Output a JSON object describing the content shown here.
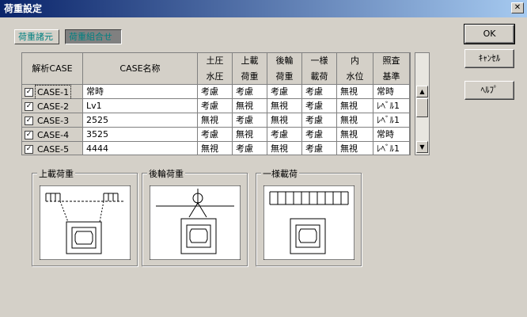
{
  "window": {
    "title": "荷重設定",
    "close_glyph": "✕"
  },
  "tabs": [
    {
      "label": "荷重諸元",
      "active": false
    },
    {
      "label": "荷重組合せ",
      "active": true
    }
  ],
  "table": {
    "headers": [
      {
        "line1": "解析CASE",
        "line2": ""
      },
      {
        "line1": "CASE名称",
        "line2": ""
      },
      {
        "line1": "土圧",
        "line2": "水圧"
      },
      {
        "line1": "上載",
        "line2": "荷重"
      },
      {
        "line1": "後輪",
        "line2": "荷重"
      },
      {
        "line1": "一様",
        "line2": "載荷"
      },
      {
        "line1": "内",
        "line2": "水位"
      },
      {
        "line1": "照査",
        "line2": "基準"
      }
    ],
    "rows": [
      {
        "checked": true,
        "case_id": "CASE-1",
        "name": "常時",
        "c1": "考慮",
        "c2": "考慮",
        "c3": "考慮",
        "c4": "考慮",
        "c5": "無視",
        "c6": "常時"
      },
      {
        "checked": true,
        "case_id": "CASE-2",
        "name": "Lv1",
        "c1": "考慮",
        "c2": "無視",
        "c3": "無視",
        "c4": "考慮",
        "c5": "無視",
        "c6": "ﾚﾍﾞﾙ1"
      },
      {
        "checked": true,
        "case_id": "CASE-3",
        "name": "2525",
        "c1": "無視",
        "c2": "考慮",
        "c3": "無視",
        "c4": "考慮",
        "c5": "無視",
        "c6": "ﾚﾍﾞﾙ1"
      },
      {
        "checked": true,
        "case_id": "CASE-4",
        "name": "3525",
        "c1": "考慮",
        "c2": "無視",
        "c3": "考慮",
        "c4": "考慮",
        "c5": "無視",
        "c6": "常時"
      },
      {
        "checked": true,
        "case_id": "CASE-5",
        "name": "4444",
        "c1": "無視",
        "c2": "考慮",
        "c3": "無視",
        "c4": "考慮",
        "c5": "無視",
        "c6": "ﾚﾍﾞﾙ1"
      }
    ],
    "check_glyph": "✓"
  },
  "panels": [
    {
      "label": "上載荷重"
    },
    {
      "label": "後輪荷重"
    },
    {
      "label": "一様載荷"
    }
  ],
  "buttons": {
    "ok": "OK",
    "cancel": "ｷｬﾝｾﾙ",
    "help": "ﾍﾙﾌﾟ"
  },
  "scrollbar": {
    "up_glyph": "▲",
    "down_glyph": "▼"
  }
}
